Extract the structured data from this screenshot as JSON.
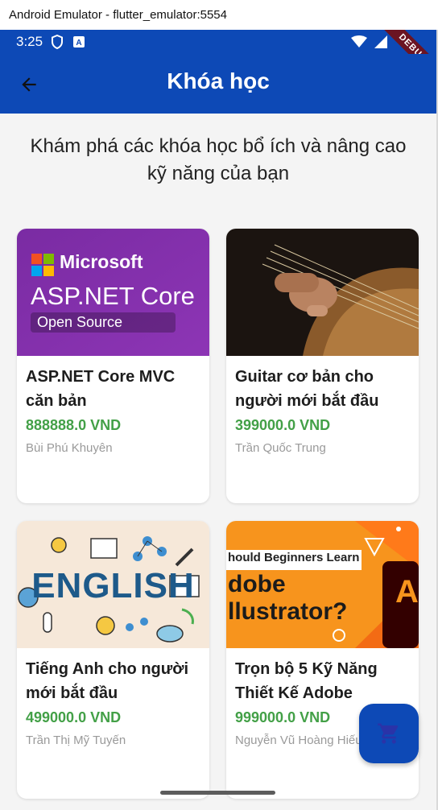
{
  "window": {
    "title": "Android Emulator - flutter_emulator:5554"
  },
  "status_bar": {
    "time": "3:25",
    "debug_label": "DEBUG"
  },
  "app_bar": {
    "title": "Khóa học",
    "back_icon": "arrow-back-icon"
  },
  "subtitle": "Khám phá các khóa học bổ ích và nâng cao kỹ năng của bạn",
  "courses": [
    {
      "title": "ASP.NET Core MVC căn bản",
      "price": "888888.0 VND",
      "author": "Bùi Phú Khuyên",
      "thumb": {
        "brand": "Microsoft",
        "product": "ASP.NET Core",
        "tagline": "Open Source"
      }
    },
    {
      "title": "Guitar cơ bản cho người mới bắt đầu",
      "price": "399000.0 VND",
      "author": "Trần Quốc Trung"
    },
    {
      "title": "Tiếng Anh cho người mới bắt đầu",
      "price": "499000.0 VND",
      "author": "Trần Thị Mỹ Tuyến",
      "thumb": {
        "word": "ENGLISH"
      }
    },
    {
      "title": "Trọn bộ 5 Kỹ Năng Thiết Kế Adobe",
      "price": "999000.0 VND",
      "author": "Nguyễn Vũ Hoàng Hiếu",
      "thumb": {
        "line1": "hould Beginners Learn",
        "line2": "dobe",
        "line3": "llustrator?",
        "letter": "A"
      }
    }
  ],
  "fab": {
    "icon": "shopping-cart-icon"
  },
  "colors": {
    "primary": "#0d49b6",
    "price": "#43a047",
    "background": "#f4f4f4"
  }
}
